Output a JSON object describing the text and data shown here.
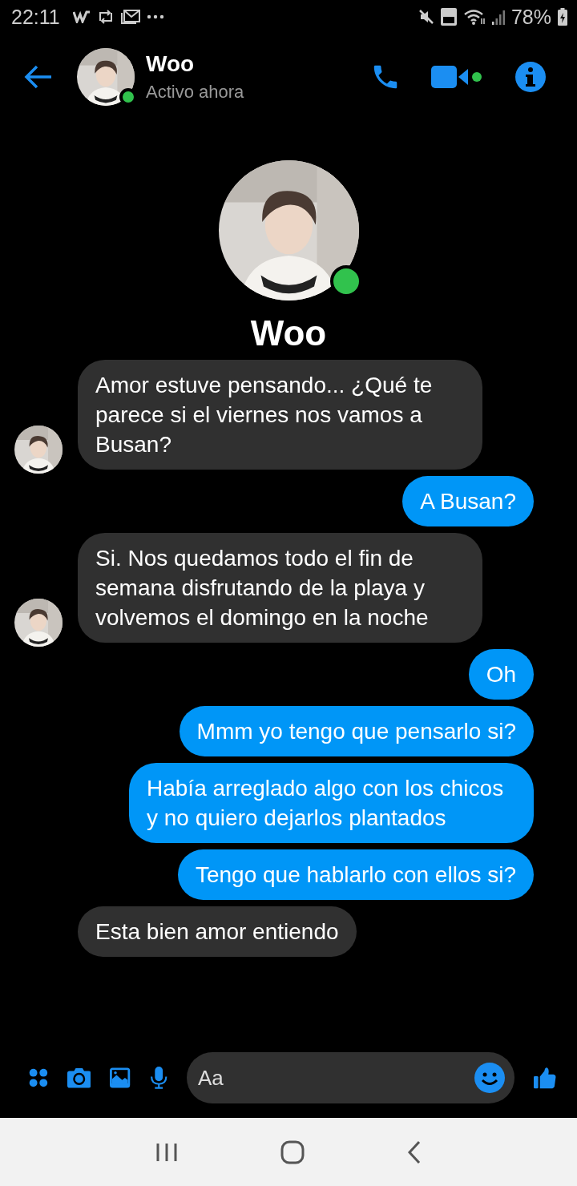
{
  "status_bar": {
    "time": "22:11",
    "battery": "78%"
  },
  "header": {
    "name": "Woo",
    "status": "Activo ahora",
    "online": true
  },
  "profile": {
    "name": "Woo",
    "online": true
  },
  "messages": [
    {
      "kind": "received",
      "text": "Amor estuve pensando... ¿Qué te parece si el viernes nos vamos a Busan?",
      "avatar": true
    },
    {
      "kind": "sent",
      "text": "A Busan?"
    },
    {
      "kind": "received",
      "text": "Si. Nos quedamos todo el fin de semana disfrutando de la playa y volvemos el domingo en la noche",
      "avatar": true
    },
    {
      "kind": "sent",
      "text": "Oh"
    },
    {
      "kind": "sent",
      "text": "Mmm yo tengo que pensarlo si?"
    },
    {
      "kind": "sent",
      "text": "Había arreglado algo con los chicos y no quiero dejarlos plantados"
    },
    {
      "kind": "sent",
      "text": "Tengo que hablarlo con ellos si?"
    },
    {
      "kind": "received",
      "text": "Esta bien amor entiendo",
      "avatar": false
    }
  ],
  "composer": {
    "placeholder": "Aa"
  }
}
